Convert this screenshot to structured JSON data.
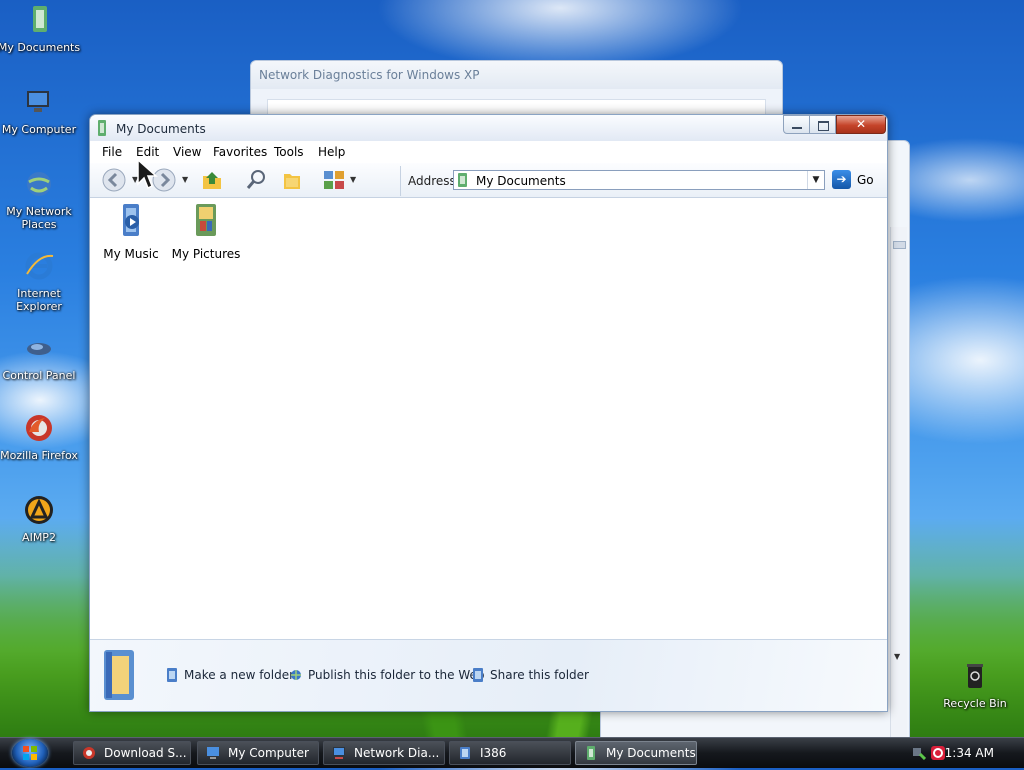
{
  "desktop": {
    "icons": [
      {
        "label": "My Documents",
        "icon": "my-documents-icon"
      },
      {
        "label": "My Computer",
        "icon": "my-computer-icon"
      },
      {
        "label": "My Network Places",
        "icon": "network-places-icon"
      },
      {
        "label": "Internet Explorer",
        "icon": "internet-explorer-icon"
      },
      {
        "label": "Control Panel",
        "icon": "control-panel-icon"
      },
      {
        "label": "Mozilla Firefox",
        "icon": "firefox-icon"
      },
      {
        "label": "AIMP2",
        "icon": "aimp-icon"
      }
    ],
    "recycle_bin": "Recycle Bin"
  },
  "background_window": {
    "title": "Network Diagnostics for Windows XP"
  },
  "window": {
    "title": "My Documents",
    "menu": [
      "File",
      "Edit",
      "View",
      "Favorites",
      "Tools",
      "Help"
    ],
    "address": {
      "label": "Address",
      "value": "My Documents",
      "go": "Go"
    },
    "items": [
      {
        "label": "My Music",
        "icon": "my-music-folder-icon"
      },
      {
        "label": "My Pictures",
        "icon": "my-pictures-folder-icon"
      }
    ],
    "tasks": [
      {
        "label": "Make a new folder",
        "icon": "new-folder-icon"
      },
      {
        "label": "Publish this folder to the Web",
        "icon": "publish-web-icon"
      },
      {
        "label": "Share this folder",
        "icon": "share-folder-icon"
      }
    ]
  },
  "taskbar": {
    "buttons": [
      {
        "label": "Download S...",
        "icon": "firefox-icon"
      },
      {
        "label": "My Computer",
        "icon": "my-computer-icon"
      },
      {
        "label": "Network Dia...",
        "icon": "network-diagnostics-icon"
      },
      {
        "label": "I386",
        "icon": "folder-icon"
      },
      {
        "label": "My Documents",
        "icon": "my-documents-icon"
      }
    ],
    "clock": "1:34 AM"
  },
  "colors": {
    "accent": "#1f5fb8",
    "close_button": "#c5442a"
  }
}
